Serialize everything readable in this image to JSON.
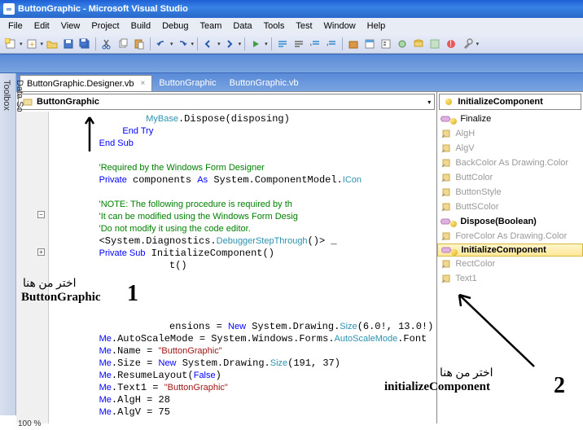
{
  "title": "ButtonGraphic - Microsoft Visual Studio",
  "menu": [
    "File",
    "Edit",
    "View",
    "Project",
    "Build",
    "Debug",
    "Team",
    "Data",
    "Tools",
    "Test",
    "Window",
    "Help"
  ],
  "tabs": [
    {
      "label": "ButtonGraphic.Designer.vb",
      "active": true
    },
    {
      "label": "ButtonGraphic",
      "active": false
    },
    {
      "label": "ButtonGraphic.vb",
      "active": false
    }
  ],
  "side_tabs": [
    "Toolbox",
    "Data Sources"
  ],
  "class_dropdown": "ButtonGraphic",
  "member_dropdown": "InitializeComponent",
  "members": [
    {
      "label": "Finalize",
      "type": "method",
      "gray": false,
      "bold": false,
      "gold": true
    },
    {
      "label": "AlgH",
      "type": "prop",
      "gray": true,
      "bold": false
    },
    {
      "label": "AlgV",
      "type": "prop",
      "gray": true,
      "bold": false
    },
    {
      "label": "BackColor As Drawing.Color",
      "type": "prop",
      "gray": true,
      "bold": false
    },
    {
      "label": "ButtColor",
      "type": "prop",
      "gray": true,
      "bold": false
    },
    {
      "label": "ButtonStyle",
      "type": "prop",
      "gray": true,
      "bold": false
    },
    {
      "label": "ButtSColor",
      "type": "prop",
      "gray": true,
      "bold": false
    },
    {
      "label": "Dispose(Boolean)",
      "type": "method",
      "gray": false,
      "bold": true,
      "gold": true
    },
    {
      "label": "ForeColor As Drawing.Color",
      "type": "prop",
      "gray": true,
      "bold": false
    },
    {
      "label": "InitializeComponent",
      "type": "method",
      "gray": false,
      "bold": true,
      "gold": true,
      "hover": true
    },
    {
      "label": "RectColor",
      "type": "prop",
      "gray": true,
      "bold": false
    },
    {
      "label": "Text1",
      "type": "prop",
      "gray": true,
      "bold": false
    }
  ],
  "code": {
    "l1": "MyBase.Dispose(disposing)",
    "l2": "End Try",
    "l3": "End Sub",
    "l4": "'Required by the Windows Form Designer",
    "l5": "Private components As System.ComponentModel.ICon",
    "l6": "'NOTE: The following procedure is required by th",
    "l7": "'It can be modified using the Windows Form Desig",
    "l8": "'Do not modify it using the code editor.",
    "l9": "<System.Diagnostics.DebuggerStepThrough()> _",
    "l10": "Private Sub InitializeComponent()",
    "l11": "t()",
    "l12": "ensions = New System.Drawing.Size(6.0!, 13.0!)",
    "l13": "Me.AutoScaleMode = System.Windows.Forms.AutoScaleMode.Font",
    "l14": "Me.Name = \"ButtonGraphic\"",
    "l15": "Me.Size = New System.Drawing.Size(191, 37)",
    "l16": "Me.ResumeLayout(False)",
    "l17": "Me.Text1 = \"ButtonGraphic\"",
    "l18": "Me.AlgH = 28",
    "l19": "Me.AlgV = 75"
  },
  "annotations": {
    "a1_ar": "اختر من هنا",
    "a1_en": "ButtonGraphic",
    "a1_num": "1",
    "a2_ar": "اختر من هنا",
    "a2_en": "initializeComponent",
    "a2_num": "2"
  },
  "zoom": "100 %"
}
